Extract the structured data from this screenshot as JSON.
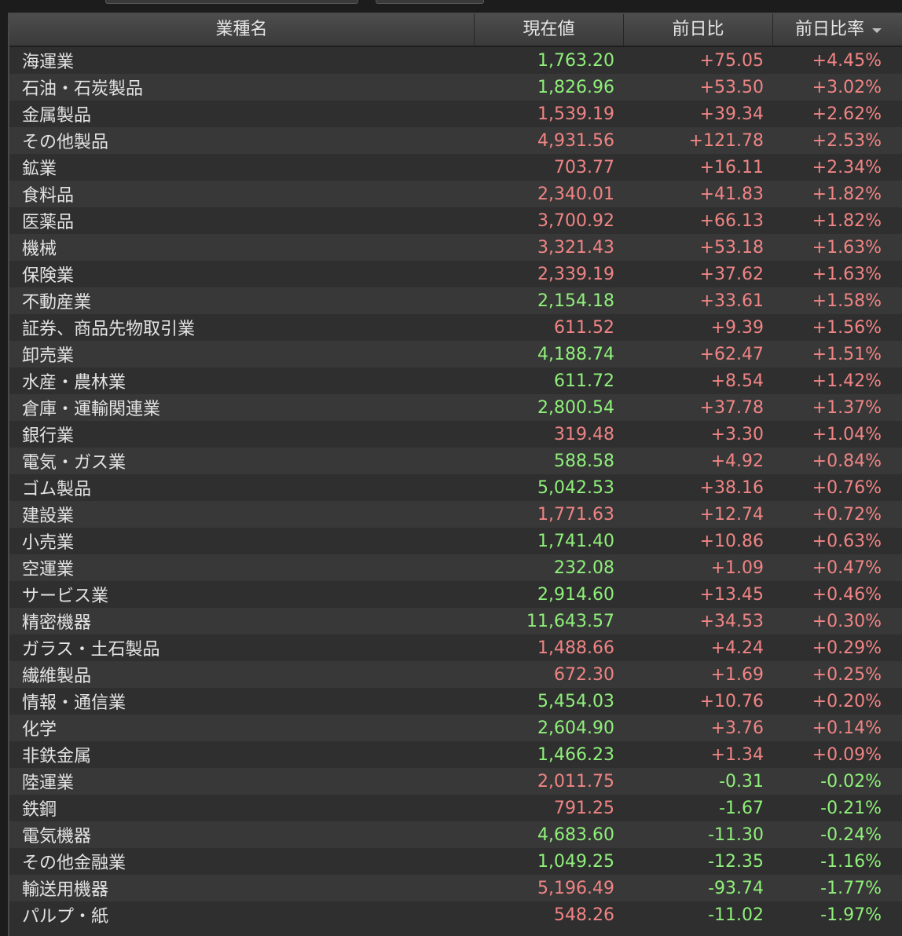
{
  "colors": {
    "up": "#f08484",
    "down": "#8ff07a",
    "background": "#2f2f2f"
  },
  "header": {
    "name": "業種名",
    "price": "現在値",
    "change": "前日比",
    "percent": "前日比率",
    "sort_icon": "caret-down-icon"
  },
  "rows": [
    {
      "name": "海運業",
      "price": "1,763.20",
      "price_color": "green",
      "change": "+75.05",
      "percent": "+4.45%"
    },
    {
      "name": "石油・石炭製品",
      "price": "1,826.96",
      "price_color": "green",
      "change": "+53.50",
      "percent": "+3.02%"
    },
    {
      "name": "金属製品",
      "price": "1,539.19",
      "price_color": "red",
      "change": "+39.34",
      "percent": "+2.62%"
    },
    {
      "name": "その他製品",
      "price": "4,931.56",
      "price_color": "red",
      "change": "+121.78",
      "percent": "+2.53%"
    },
    {
      "name": "鉱業",
      "price": "703.77",
      "price_color": "red",
      "change": "+16.11",
      "percent": "+2.34%"
    },
    {
      "name": "食料品",
      "price": "2,340.01",
      "price_color": "red",
      "change": "+41.83",
      "percent": "+1.82%"
    },
    {
      "name": "医薬品",
      "price": "3,700.92",
      "price_color": "red",
      "change": "+66.13",
      "percent": "+1.82%"
    },
    {
      "name": "機械",
      "price": "3,321.43",
      "price_color": "red",
      "change": "+53.18",
      "percent": "+1.63%"
    },
    {
      "name": "保険業",
      "price": "2,339.19",
      "price_color": "red",
      "change": "+37.62",
      "percent": "+1.63%"
    },
    {
      "name": "不動産業",
      "price": "2,154.18",
      "price_color": "green",
      "change": "+33.61",
      "percent": "+1.58%"
    },
    {
      "name": "証券、商品先物取引業",
      "price": "611.52",
      "price_color": "red",
      "change": "+9.39",
      "percent": "+1.56%"
    },
    {
      "name": "卸売業",
      "price": "4,188.74",
      "price_color": "green",
      "change": "+62.47",
      "percent": "+1.51%"
    },
    {
      "name": "水産・農林業",
      "price": "611.72",
      "price_color": "green",
      "change": "+8.54",
      "percent": "+1.42%"
    },
    {
      "name": "倉庫・運輸関連業",
      "price": "2,800.54",
      "price_color": "green",
      "change": "+37.78",
      "percent": "+1.37%"
    },
    {
      "name": "銀行業",
      "price": "319.48",
      "price_color": "red",
      "change": "+3.30",
      "percent": "+1.04%"
    },
    {
      "name": "電気・ガス業",
      "price": "588.58",
      "price_color": "green",
      "change": "+4.92",
      "percent": "+0.84%"
    },
    {
      "name": "ゴム製品",
      "price": "5,042.53",
      "price_color": "green",
      "change": "+38.16",
      "percent": "+0.76%"
    },
    {
      "name": "建設業",
      "price": "1,771.63",
      "price_color": "red",
      "change": "+12.74",
      "percent": "+0.72%"
    },
    {
      "name": "小売業",
      "price": "1,741.40",
      "price_color": "green",
      "change": "+10.86",
      "percent": "+0.63%"
    },
    {
      "name": "空運業",
      "price": "232.08",
      "price_color": "green",
      "change": "+1.09",
      "percent": "+0.47%"
    },
    {
      "name": "サービス業",
      "price": "2,914.60",
      "price_color": "green",
      "change": "+13.45",
      "percent": "+0.46%"
    },
    {
      "name": "精密機器",
      "price": "11,643.57",
      "price_color": "green",
      "change": "+34.53",
      "percent": "+0.30%"
    },
    {
      "name": "ガラス・土石製品",
      "price": "1,488.66",
      "price_color": "red",
      "change": "+4.24",
      "percent": "+0.29%"
    },
    {
      "name": "繊維製品",
      "price": "672.30",
      "price_color": "red",
      "change": "+1.69",
      "percent": "+0.25%"
    },
    {
      "name": "情報・通信業",
      "price": "5,454.03",
      "price_color": "green",
      "change": "+10.76",
      "percent": "+0.20%"
    },
    {
      "name": "化学",
      "price": "2,604.90",
      "price_color": "green",
      "change": "+3.76",
      "percent": "+0.14%"
    },
    {
      "name": "非鉄金属",
      "price": "1,466.23",
      "price_color": "green",
      "change": "+1.34",
      "percent": "+0.09%"
    },
    {
      "name": "陸運業",
      "price": "2,011.75",
      "price_color": "red",
      "change": "-0.31",
      "percent": "-0.02%"
    },
    {
      "name": "鉄鋼",
      "price": "791.25",
      "price_color": "red",
      "change": "-1.67",
      "percent": "-0.21%"
    },
    {
      "name": "電気機器",
      "price": "4,683.60",
      "price_color": "green",
      "change": "-11.30",
      "percent": "-0.24%"
    },
    {
      "name": "その他金融業",
      "price": "1,049.25",
      "price_color": "green",
      "change": "-12.35",
      "percent": "-1.16%"
    },
    {
      "name": "輸送用機器",
      "price": "5,196.49",
      "price_color": "red",
      "change": "-93.74",
      "percent": "-1.77%"
    },
    {
      "name": "パルプ・紙",
      "price": "548.26",
      "price_color": "red",
      "change": "-11.02",
      "percent": "-1.97%"
    }
  ]
}
